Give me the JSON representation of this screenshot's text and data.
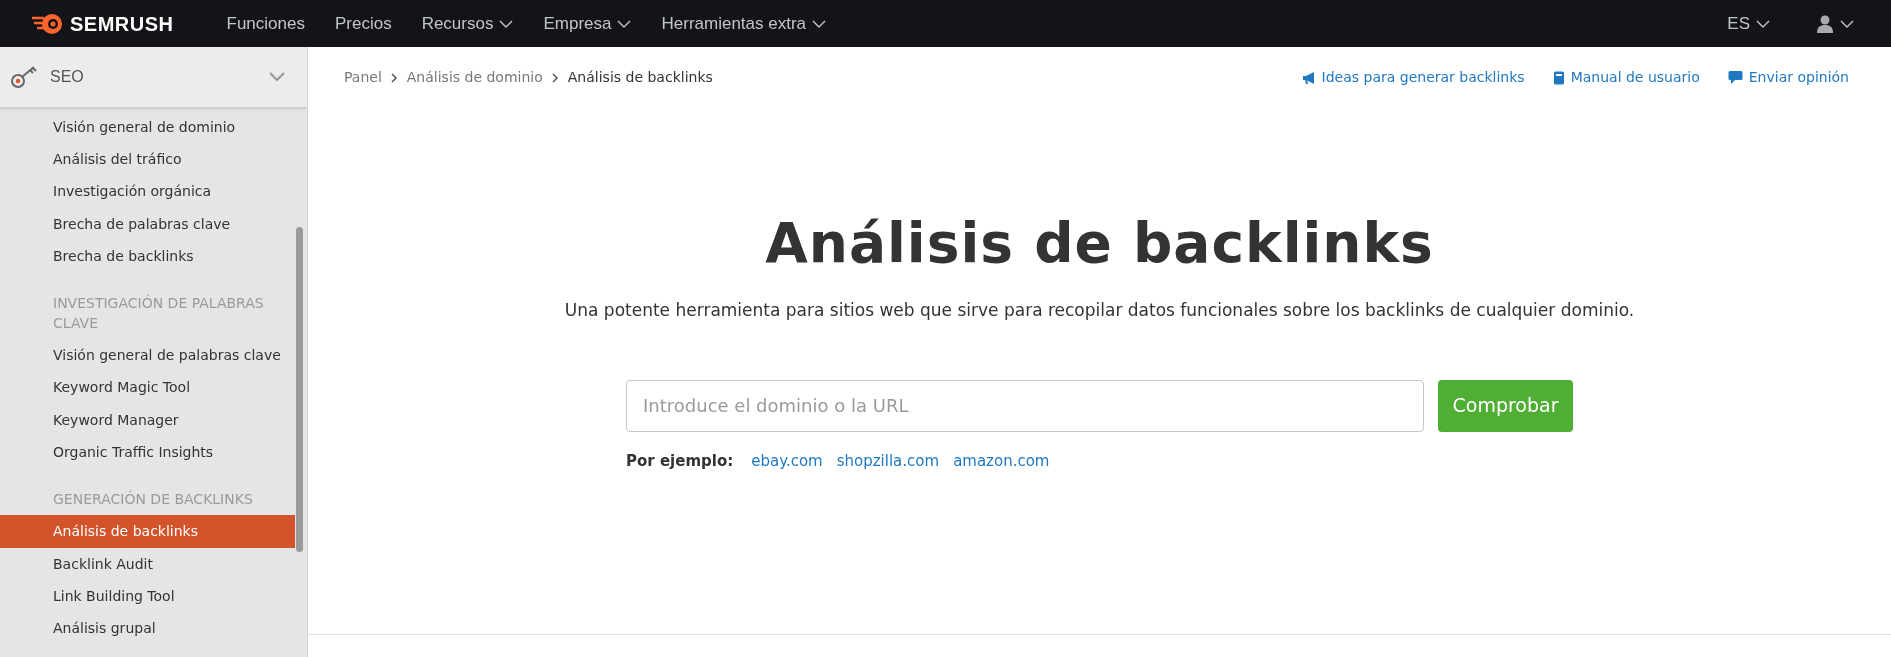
{
  "topbar": {
    "logo": "SEMRUSH",
    "nav": [
      {
        "label": "Funciones",
        "dropdown": false
      },
      {
        "label": "Precios",
        "dropdown": false
      },
      {
        "label": "Recursos",
        "dropdown": true
      },
      {
        "label": "Empresa",
        "dropdown": true
      },
      {
        "label": "Herramientas extra",
        "dropdown": true
      }
    ],
    "language": "ES"
  },
  "sidebar": {
    "section": "SEO",
    "groups": [
      {
        "items": [
          {
            "label": "Visión general de dominio",
            "selected": false
          },
          {
            "label": "Análisis del tráfico",
            "selected": false
          },
          {
            "label": "Investigación orgánica",
            "selected": false
          },
          {
            "label": "Brecha de palabras clave",
            "selected": false
          },
          {
            "label": "Brecha de backlinks",
            "selected": false
          }
        ]
      },
      {
        "heading": "INVESTIGACIÓN DE PALABRAS CLAVE",
        "items": [
          {
            "label": "Visión general de palabras clave",
            "selected": false
          },
          {
            "label": "Keyword Magic Tool",
            "selected": false
          },
          {
            "label": "Keyword Manager",
            "selected": false
          },
          {
            "label": "Organic Traffic Insights",
            "selected": false
          }
        ]
      },
      {
        "heading": "GENERACIÓN DE BACKLINKS",
        "items": [
          {
            "label": "Análisis de backlinks",
            "selected": true
          },
          {
            "label": "Backlink Audit",
            "selected": false
          },
          {
            "label": "Link Building Tool",
            "selected": false
          },
          {
            "label": "Análisis grupal",
            "selected": false
          }
        ]
      }
    ]
  },
  "breadcrumb": [
    {
      "label": "Panel"
    },
    {
      "label": "Análisis de dominio"
    },
    {
      "label": "Análisis de backlinks"
    }
  ],
  "header_links": [
    {
      "label": "Ideas para generar backlinks",
      "kind": "megaphone"
    },
    {
      "label": "Manual de usuario",
      "kind": "book"
    },
    {
      "label": "Enviar opinión",
      "kind": "chat"
    }
  ],
  "main": {
    "title": "Análisis de backlinks",
    "subtitle": "Una potente herramienta para sitios web que sirve para recopilar datos funcionales sobre los backlinks de cualquier dominio.",
    "search": {
      "placeholder": "Introduce el dominio o la URL"
    },
    "button": "Comprobar",
    "examples": {
      "label": "Por ejemplo:",
      "links": [
        "ebay.com",
        "shopzilla.com",
        "amazon.com"
      ]
    }
  }
}
